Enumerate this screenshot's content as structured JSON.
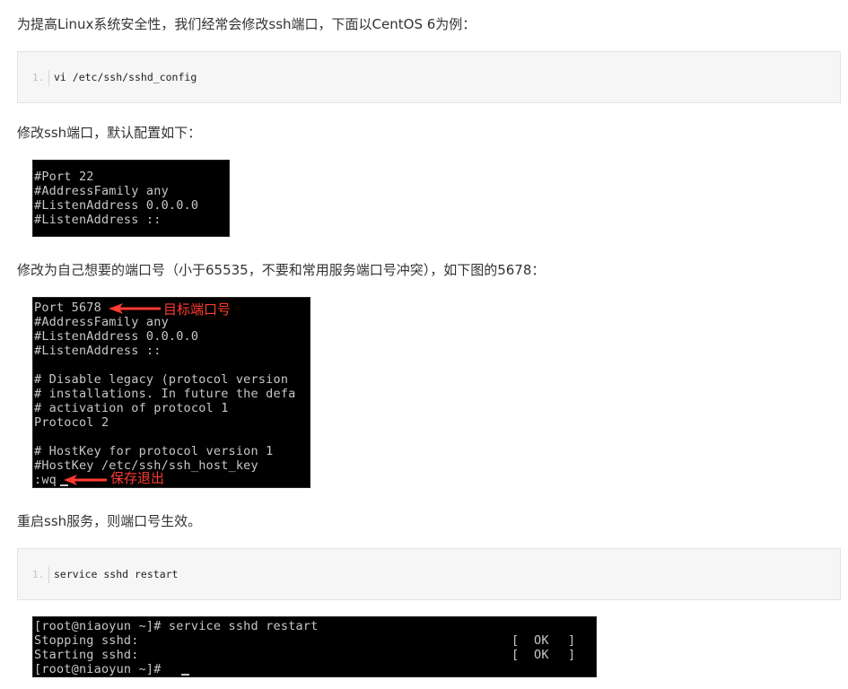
{
  "paragraphs": {
    "intro": "为提高Linux系统安全性，我们经常会修改ssh端口，下面以CentOS 6为例：",
    "modify_default": "修改ssh端口，默认配置如下：",
    "modify_to": "修改为自己想要的端口号（小于65535，不要和常用服务端口号冲突），如下图的5678：",
    "restart": "重启ssh服务，则端口号生效。"
  },
  "code_blocks": [
    {
      "line_number": "1.",
      "code": "vi /etc/ssh/sshd_config"
    },
    {
      "line_number": "1.",
      "code": "service sshd restart"
    }
  ],
  "terminal_default": [
    "#Port 22",
    "#AddressFamily any",
    "#ListenAddress 0.0.0.0",
    "#ListenAddress ::"
  ],
  "terminal_modified": [
    "Port 5678",
    "#AddressFamily any",
    "#ListenAddress 0.0.0.0",
    "#ListenAddress ::",
    "",
    "# Disable legacy (protocol version",
    "# installations. In future the defa",
    "# activation of protocol 1",
    "Protocol 2",
    "",
    "# HostKey for protocol version 1",
    "#HostKey /etc/ssh/ssh_host_key",
    ":wq"
  ],
  "annotations": {
    "target_port": "目标端口号",
    "save_exit": "保存退出"
  },
  "terminal_restart": {
    "line1": "[root@niaoyun ~]# service sshd restart",
    "line2": "Stopping sshd:",
    "line3": "Starting sshd:",
    "line4": "[root@niaoyun ~]# ",
    "bracket_open": "[",
    "bracket_close": "]",
    "ok": "OK"
  },
  "colors": {
    "annotation": "#ff3b30",
    "ok_status": "#22c522",
    "terminal_bg": "#000000"
  }
}
